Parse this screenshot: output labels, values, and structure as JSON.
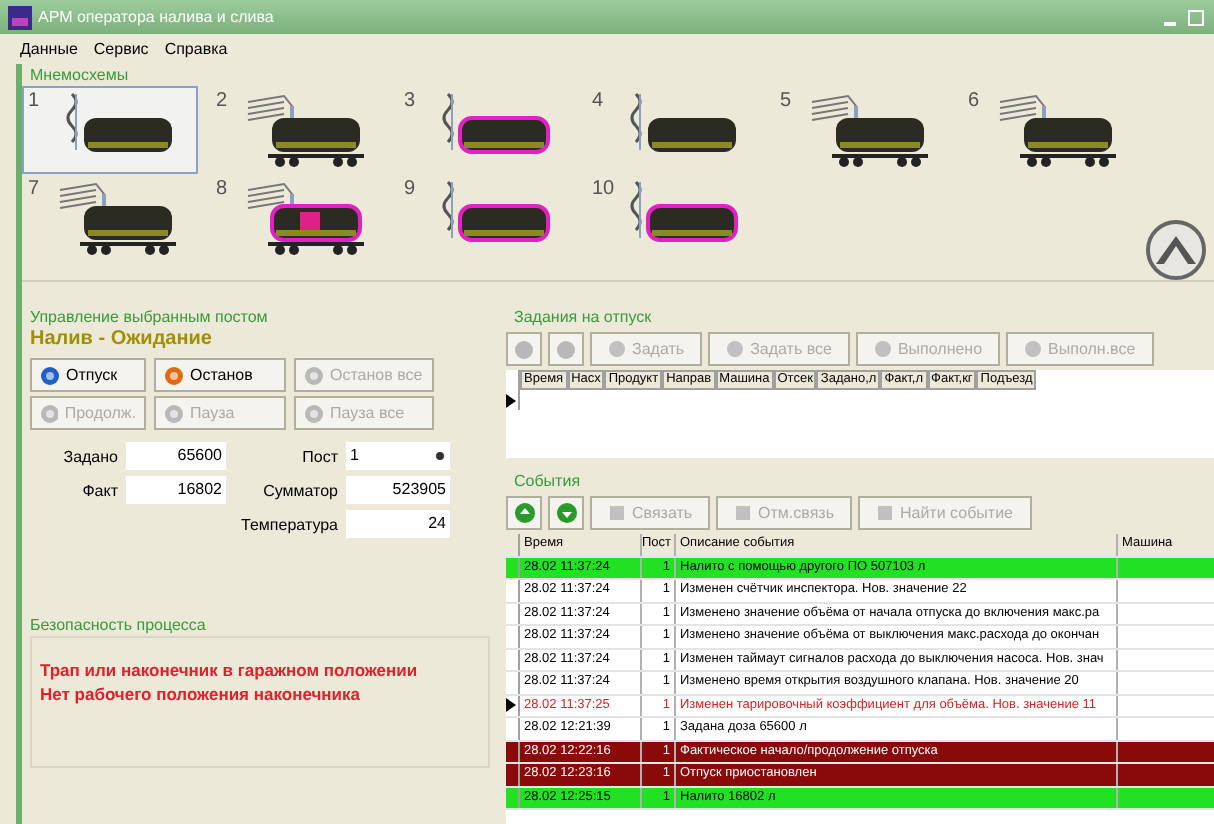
{
  "window": {
    "title": "АРМ оператора налива и слива"
  },
  "menu": [
    "Данные",
    "Сервис",
    "Справка"
  ],
  "mnemonics": {
    "title": "Мнемосхемы",
    "tanks": [
      {
        "number": "1",
        "kind": "tank",
        "alarm": false,
        "fault": false,
        "selected": true
      },
      {
        "number": "2",
        "kind": "railcar",
        "alarm": false,
        "fault": false,
        "selected": false
      },
      {
        "number": "3",
        "kind": "tank",
        "alarm": true,
        "fault": false,
        "selected": false
      },
      {
        "number": "4",
        "kind": "tank",
        "alarm": false,
        "fault": false,
        "selected": false
      },
      {
        "number": "5",
        "kind": "railcar",
        "alarm": false,
        "fault": false,
        "selected": false
      },
      {
        "number": "6",
        "kind": "railcar",
        "alarm": false,
        "fault": false,
        "selected": false
      },
      {
        "number": "7",
        "kind": "railcar",
        "alarm": false,
        "fault": false,
        "selected": false
      },
      {
        "number": "8",
        "kind": "railcar",
        "alarm": true,
        "fault": true,
        "selected": false
      },
      {
        "number": "9",
        "kind": "tank",
        "alarm": true,
        "fault": false,
        "selected": false
      },
      {
        "number": "10",
        "kind": "tank",
        "alarm": true,
        "fault": false,
        "selected": false
      }
    ]
  },
  "control": {
    "title": "Управление выбранным постом",
    "status": "Налив - Ожидание",
    "buttons": [
      {
        "label": "Отпуск",
        "disabled": false
      },
      {
        "label": "Останов",
        "disabled": false
      },
      {
        "label": "Останов все",
        "disabled": true
      },
      {
        "label": "Продолж.",
        "disabled": true
      },
      {
        "label": "Пауза",
        "disabled": true
      },
      {
        "label": "Пауза все",
        "disabled": true
      }
    ],
    "set_label": "Задано",
    "set_value": "65600",
    "fact_label": "Факт",
    "fact_value": "16802",
    "post_label": "Пост",
    "post_value": "1",
    "total_label": "Сумматор",
    "total_value": "523905",
    "temp_label": "Температура",
    "temp_value": "24"
  },
  "safety": {
    "title": "Безопасность процесса",
    "messages": [
      "Трап или наконечник в гаражном положении",
      "Нет рабочего положения наконечника"
    ]
  },
  "tasks": {
    "title": "Задания на отпуск",
    "buttons": [
      {
        "label": "Задать",
        "disabled": true
      },
      {
        "label": "Задать все",
        "disabled": true
      },
      {
        "label": "Выполнено",
        "disabled": true
      },
      {
        "label": "Выполн.все",
        "disabled": true
      }
    ],
    "columns": [
      "Время",
      "Насх",
      "Продукт",
      "Направ",
      "Машина",
      "Отсек",
      "Задано,л",
      "Факт,л",
      "Факт,кг",
      "Подъезд"
    ]
  },
  "events": {
    "title": "События",
    "buttons": [
      {
        "label": "Связать",
        "disabled": true
      },
      {
        "label": "Отм.связь",
        "disabled": true
      },
      {
        "label": "Найти событие",
        "disabled": true
      }
    ],
    "columns": [
      "Время",
      "Пост",
      "Описание события",
      "Машина"
    ],
    "rows": [
      {
        "time": "28.02 11:37:24",
        "post": "1",
        "text": "Налито с помощью другого ПО 507103 л",
        "kind": "ok",
        "selected": false
      },
      {
        "time": "28.02 11:37:24",
        "post": "1",
        "text": "Изменен счётчик инспектора. Нов. значение 22",
        "kind": "info",
        "selected": false
      },
      {
        "time": "28.02 11:37:24",
        "post": "1",
        "text": "Изменено значение объёма от начала отпуска до включения макс.ра",
        "kind": "info",
        "selected": false
      },
      {
        "time": "28.02 11:37:24",
        "post": "1",
        "text": "Изменено значение объёма от выключения макс.расхода до окончан",
        "kind": "info",
        "selected": false
      },
      {
        "time": "28.02 11:37:24",
        "post": "1",
        "text": "Изменен таймаут сигналов расхода до выключения насоса. Нов. знач",
        "kind": "info",
        "selected": false
      },
      {
        "time": "28.02 11:37:24",
        "post": "1",
        "text": "Изменено время открытия воздушного клапана. Нов. значение 20",
        "kind": "info",
        "selected": false
      },
      {
        "time": "28.02 11:37:25",
        "post": "1",
        "text": "Изменен тарировочный коэффициент для объёма. Нов. значение 11",
        "kind": "warning",
        "selected": true
      },
      {
        "time": "28.02 12:21:39",
        "post": "1",
        "text": "Задана доза 65600 л",
        "kind": "info",
        "selected": false
      },
      {
        "time": "28.02 12:22:16",
        "post": "1",
        "text": "Фактическое начало/продолжение отпуска",
        "kind": "alarm",
        "selected": false
      },
      {
        "time": "28.02 12:23:16",
        "post": "1",
        "text": "Отпуск приостановлен",
        "kind": "alarm",
        "selected": false
      },
      {
        "time": "28.02 12:25:15",
        "post": "1",
        "text": "Налито 16802 л",
        "kind": "ok",
        "selected": false
      }
    ]
  }
}
